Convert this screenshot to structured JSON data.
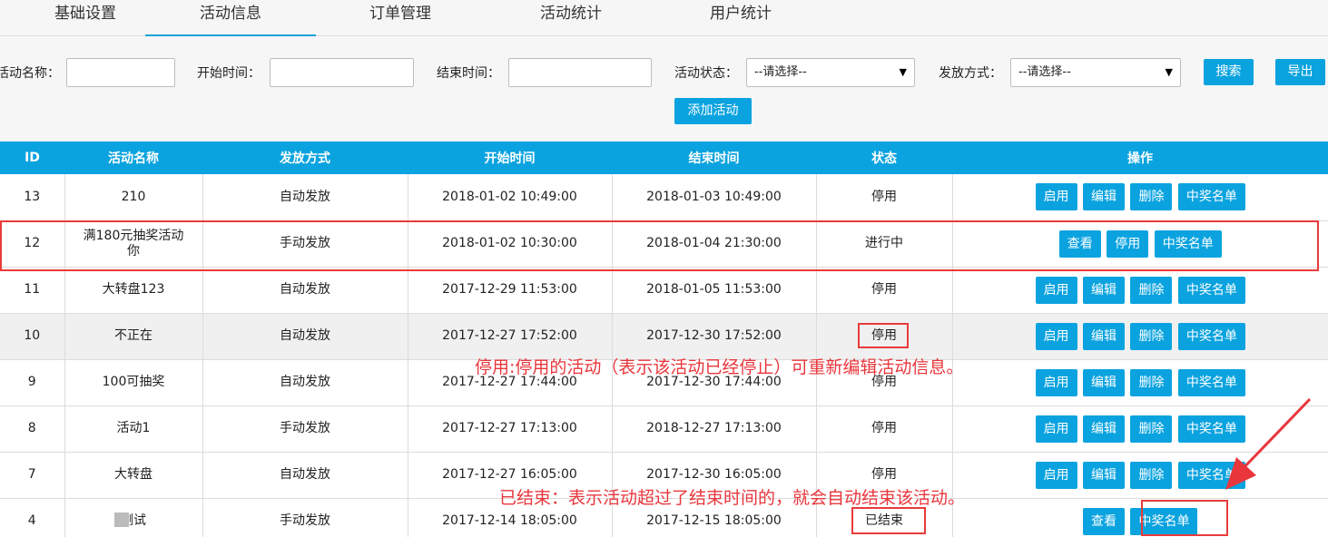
{
  "tabs": [
    "基础设置",
    "活动信息",
    "订单管理",
    "活动统计",
    "用户统计"
  ],
  "active_tab": 1,
  "filters": {
    "name_label": "活动名称：",
    "start_label": "开始时间：",
    "end_label": "结束时间：",
    "status_label": "活动状态：",
    "status_value": "--请选择--",
    "method_label": "发放方式：",
    "method_value": "--请选择--",
    "search_label": "搜索",
    "export_label": "导出",
    "add_label": "添加活动"
  },
  "table": {
    "headers": [
      "ID",
      "活动名称",
      "发放方式",
      "开始时间",
      "结束时间",
      "状态",
      "操作"
    ],
    "rows": [
      {
        "id": "13",
        "name": "210",
        "method": "自动发放",
        "start": "2018-01-02 10:49:00",
        "end": "2018-01-03 10:49:00",
        "status": "停用",
        "actions": [
          "启用",
          "编辑",
          "删除",
          "中奖名单"
        ]
      },
      {
        "id": "12",
        "name": "满180元抽奖活动你",
        "method": "手动发放",
        "start": "2018-01-02 10:30:00",
        "end": "2018-01-04 21:30:00",
        "status": "进行中",
        "actions": [
          "查看",
          "停用",
          "中奖名单"
        ]
      },
      {
        "id": "11",
        "name": "大转盘123",
        "method": "自动发放",
        "start": "2017-12-29 11:53:00",
        "end": "2018-01-05 11:53:00",
        "status": "停用",
        "actions": [
          "启用",
          "编辑",
          "删除",
          "中奖名单"
        ]
      },
      {
        "id": "10",
        "name": "不正在",
        "method": "自动发放",
        "start": "2017-12-27 17:52:00",
        "end": "2017-12-30 17:52:00",
        "status": "停用",
        "actions": [
          "启用",
          "编辑",
          "删除",
          "中奖名单"
        ]
      },
      {
        "id": "9",
        "name": "100可抽奖",
        "method": "自动发放",
        "start": "2017-12-27 17:44:00",
        "end": "2017-12-30 17:44:00",
        "status": "停用",
        "actions": [
          "启用",
          "编辑",
          "删除",
          "中奖名单"
        ]
      },
      {
        "id": "8",
        "name": "活动1",
        "method": "手动发放",
        "start": "2017-12-27 17:13:00",
        "end": "2018-12-27 17:13:00",
        "status": "停用",
        "actions": [
          "启用",
          "编辑",
          "删除",
          "中奖名单"
        ]
      },
      {
        "id": "7",
        "name": "大转盘",
        "method": "自动发放",
        "start": "2017-12-27 16:05:00",
        "end": "2017-12-30 16:05:00",
        "status": "停用",
        "actions": [
          "启用",
          "编辑",
          "删除",
          "中奖名单"
        ]
      },
      {
        "id": "4",
        "name": "测试",
        "method": "手动发放",
        "start": "2017-12-14 18:05:00",
        "end": "2017-12-15 18:05:00",
        "status": "已结束",
        "actions": [
          "查看",
          "中奖名单"
        ]
      }
    ]
  },
  "annotations": {
    "note_disabled": "停用:停用的活动（表示该活动已经停止）可重新编辑活动信息。",
    "note_ended": "已结束：表示活动超过了结束时间的，就会自动结束该活动。"
  },
  "colors": {
    "accent": "#0aa3df",
    "annotation": "#e8363c"
  }
}
